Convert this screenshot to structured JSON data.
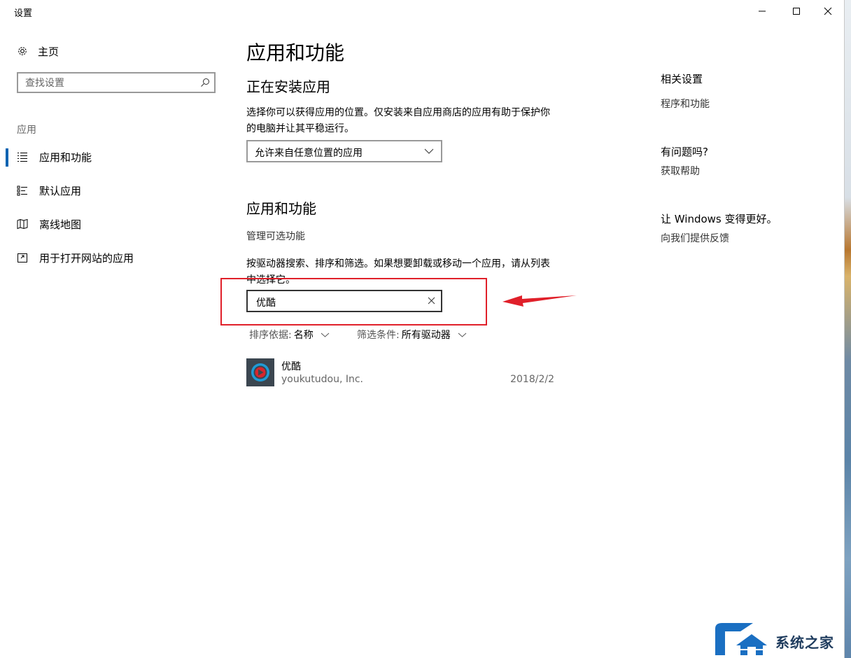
{
  "window": {
    "title": "设置"
  },
  "sidebar": {
    "home_label": "主页",
    "search_placeholder": "查找设置",
    "section_label": "应用",
    "items": [
      {
        "label": "应用和功能",
        "icon": "list-icon",
        "active": true
      },
      {
        "label": "默认应用",
        "icon": "default-apps-icon",
        "active": false
      },
      {
        "label": "离线地图",
        "icon": "map-icon",
        "active": false
      },
      {
        "label": "用于打开网站的应用",
        "icon": "open-website-icon",
        "active": false
      }
    ]
  },
  "main": {
    "page_title": "应用和功能",
    "install": {
      "heading": "正在安装应用",
      "description": "选择你可以获得应用的位置。仅安装来自应用商店的应用有助于保护你的电脑并让其平稳运行。",
      "dropdown_value": "允许来自任意位置的应用"
    },
    "apps": {
      "heading": "应用和功能",
      "manage_optional": "管理可选功能",
      "description": "按驱动器搜索、排序和筛选。如果想要卸载或移动一个应用，请从列表中选择它。",
      "search_value": "优酷",
      "sort_label": "排序依据:",
      "sort_value": "名称",
      "filter_label": "筛选条件:",
      "filter_value": "所有驱动器",
      "list": [
        {
          "name": "优酷",
          "publisher": "youkutudou, Inc.",
          "date": "2018/2/2"
        }
      ]
    }
  },
  "right_panel": {
    "related_heading": "相关设置",
    "related_link": "程序和功能",
    "help_heading": "有问题吗?",
    "help_link": "获取帮助",
    "feedback_heading": "让 Windows 变得更好。",
    "feedback_link": "向我们提供反馈"
  },
  "annotation": {
    "highlight_color": "#e0202a"
  },
  "watermark": {
    "text": "系统之家"
  },
  "colors": {
    "accent": "#0063b1",
    "app_icon_ring": "#1f9bd6",
    "app_icon_center": "#d8262d"
  }
}
